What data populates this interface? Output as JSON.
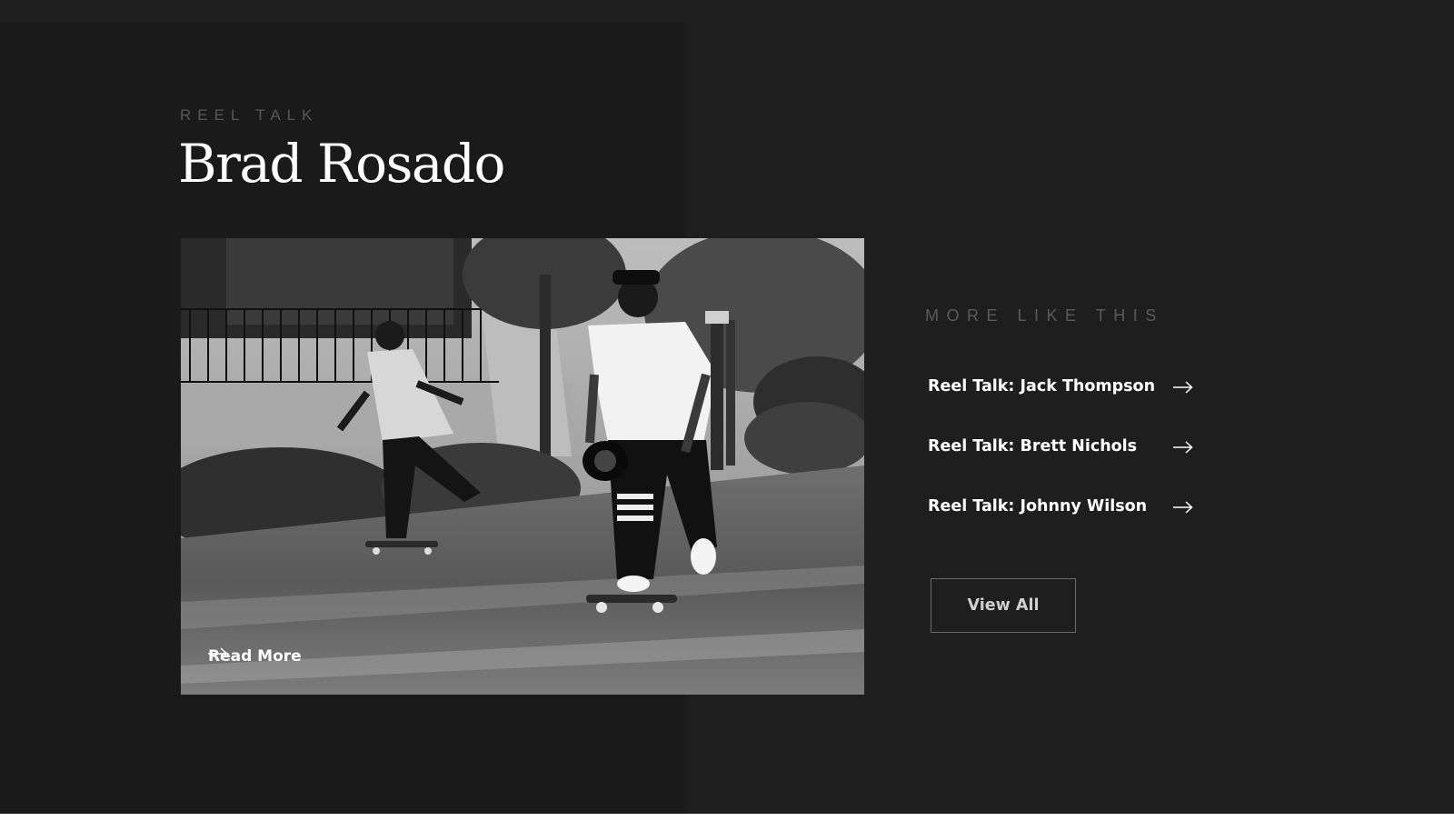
{
  "article": {
    "eyebrow": "REEL TALK",
    "title": "Brad Rosado",
    "read_more_label": "Read More",
    "read_more_icon": "arrow-right-icon",
    "image_description_icon": "skateboarders-photo"
  },
  "sidebar": {
    "heading": "MORE LIKE THIS",
    "items": [
      {
        "label": "Reel Talk: Jack Thompson",
        "icon": "arrow-right-icon"
      },
      {
        "label": "Reel Talk: Brett Nichols",
        "icon": "arrow-right-icon"
      },
      {
        "label": "Reel Talk: Johnny Wilson",
        "icon": "arrow-right-icon"
      }
    ],
    "view_all_label": "View All"
  },
  "colors": {
    "page_background": "#1e1e1e",
    "panel_background": "#1a1a1a",
    "title_text": "#ffffff",
    "muted_text": "#575757",
    "button_border": "#6a6a6a"
  }
}
